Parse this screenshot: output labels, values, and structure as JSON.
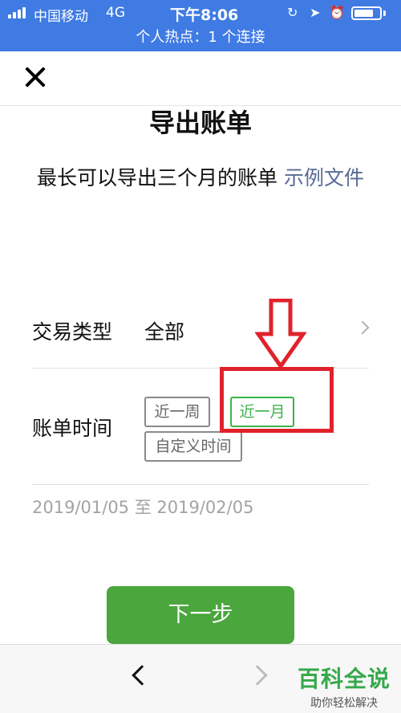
{
  "status_bar": {
    "carrier": "中国移动",
    "network": "4G",
    "time": "下午8:06",
    "battery_level": 0.75,
    "icons": [
      "rotation-lock-icon",
      "location-icon",
      "alarm-icon"
    ]
  },
  "hotspot_banner": "个人热点：1 个连接",
  "page": {
    "title": "导出账单",
    "description": "最长可以导出三个月的账单",
    "example_link": "示例文件"
  },
  "form": {
    "type_label": "交易类型",
    "type_value": "全部",
    "time_label": "账单时间",
    "time_options": [
      "近一周",
      "近一月",
      "自定义时间"
    ],
    "selected_time_option": "近一月",
    "date_range": "2019/01/05 至 2019/02/05"
  },
  "next_button": "下一步",
  "watermark": {
    "main": "百科全说",
    "sub": "助你轻松解决"
  },
  "colors": {
    "status_bar": "#3f7be3",
    "accent_green": "#3bb34a",
    "button_green": "#4aa63d",
    "link": "#576b95",
    "annotation_red": "#e0222b"
  }
}
